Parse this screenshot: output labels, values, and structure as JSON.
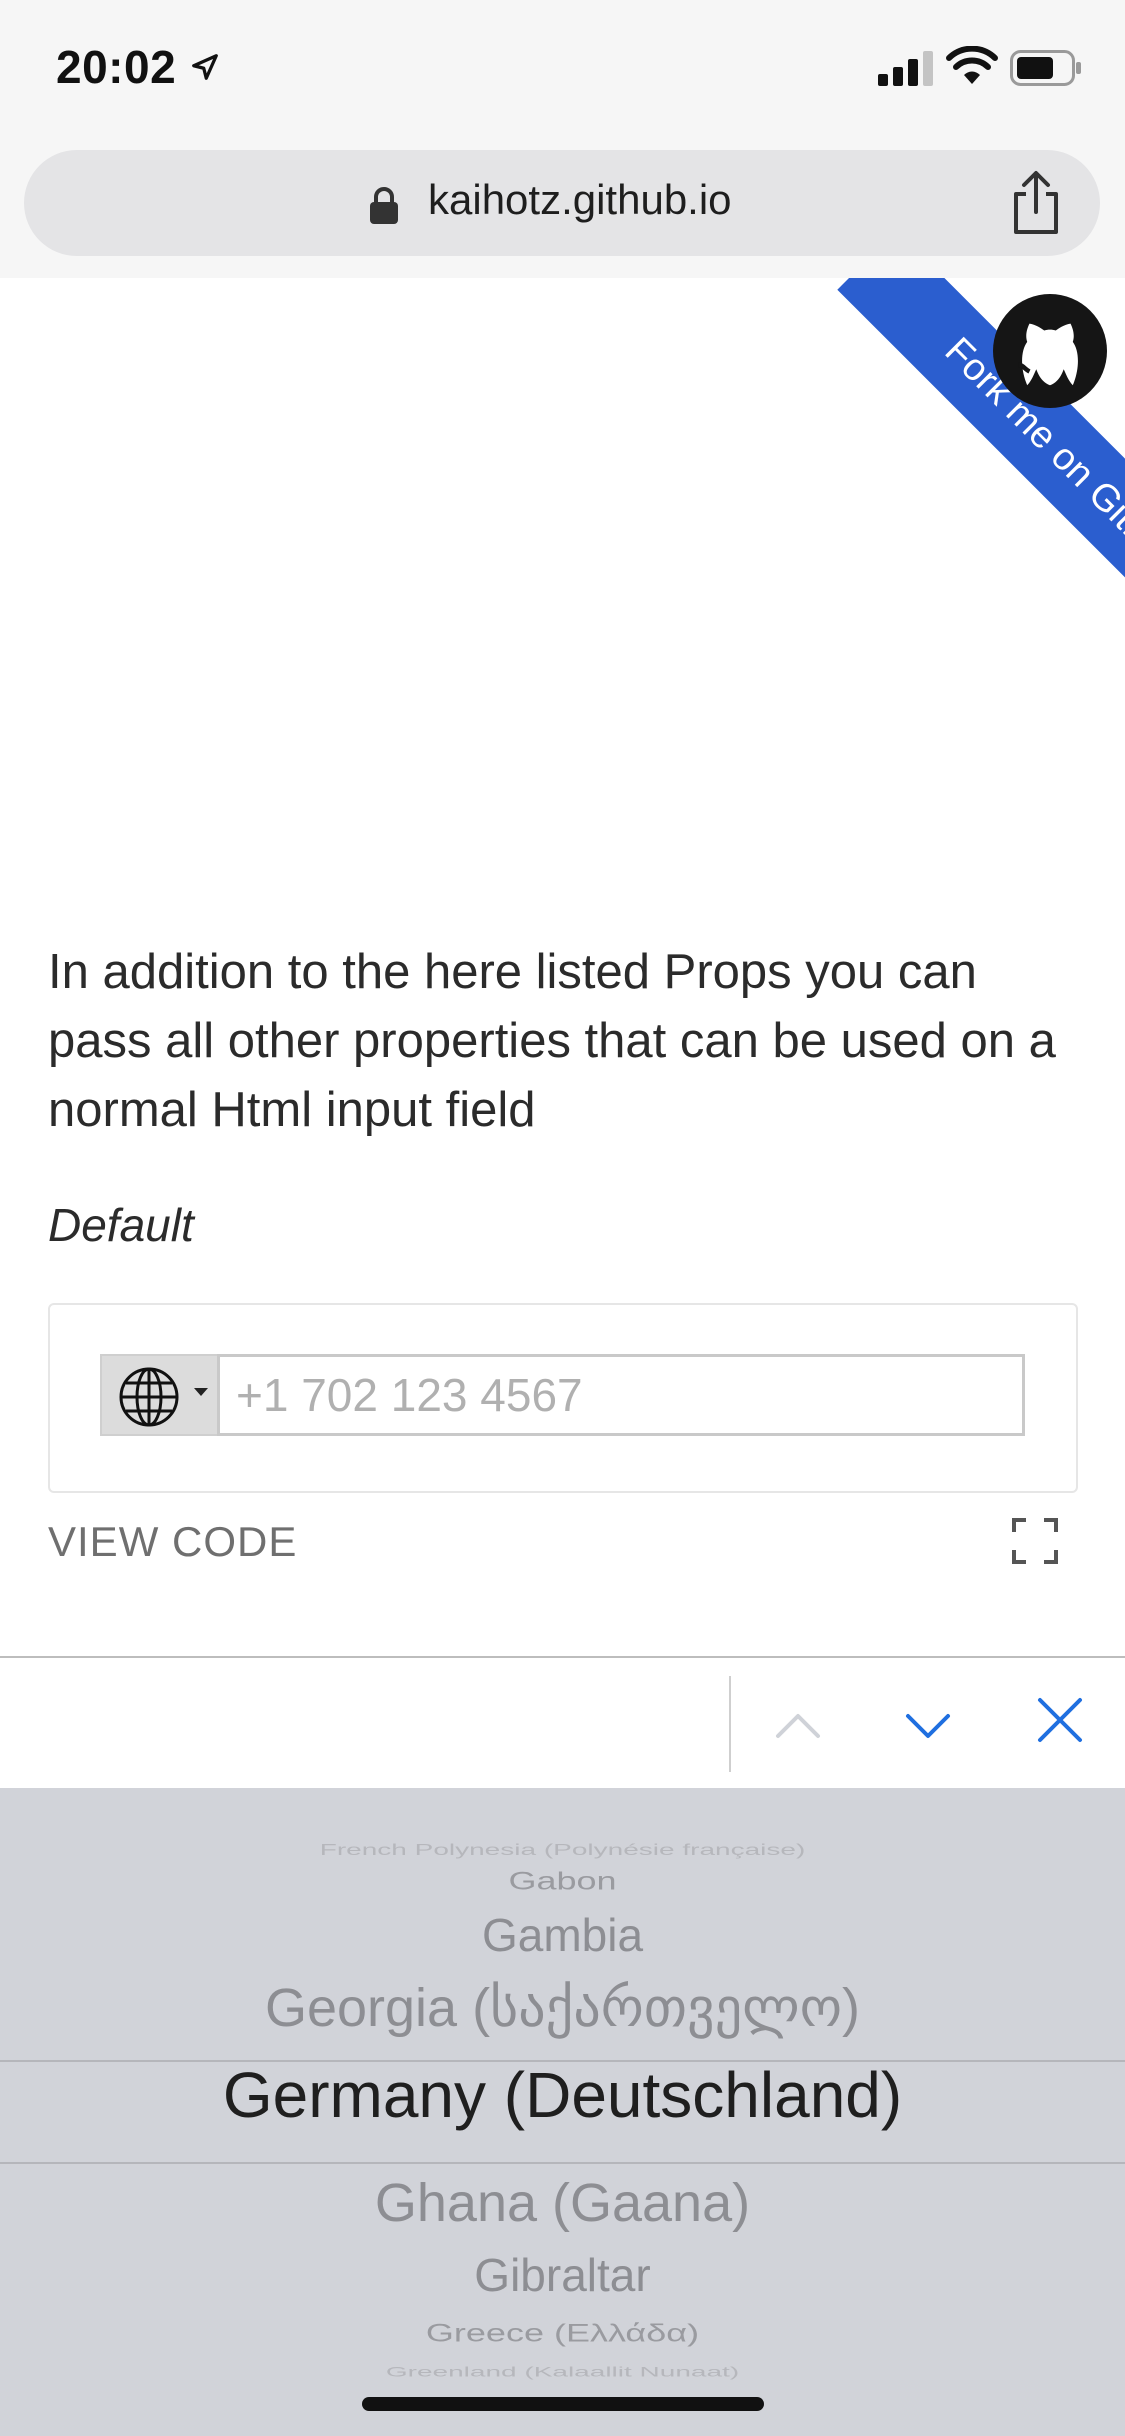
{
  "status_bar": {
    "time": "20:02",
    "icons": [
      "location-arrow-icon",
      "cellular-signal-icon",
      "wifi-icon",
      "battery-icon"
    ]
  },
  "browser": {
    "url": "kaihotz.github.io",
    "icons": [
      "lock-icon",
      "share-icon"
    ]
  },
  "ribbon": {
    "label": "Fork me on GitHub",
    "color": "#2b5ecf"
  },
  "page": {
    "description": "In addition to the here listed Props you can pass all other properties that can be used on a normal Html input field",
    "example_label": "Default",
    "phone_placeholder": "+1 702 123 4567",
    "phone_value": "",
    "view_code_label": "VIEW CODE"
  },
  "picker": {
    "items": [
      "French Polynesia (Polynésie française)",
      "Gabon",
      "Gambia",
      "Georgia (საქართველო)",
      "Germany (Deutschland)",
      "Ghana (Gaana)",
      "Gibraltar",
      "Greece (Ελλάδα)",
      "Greenland (Kalaallit Nunaat)"
    ],
    "selected": "Germany (Deutschland)"
  },
  "accent_color": "#1f6fe0"
}
